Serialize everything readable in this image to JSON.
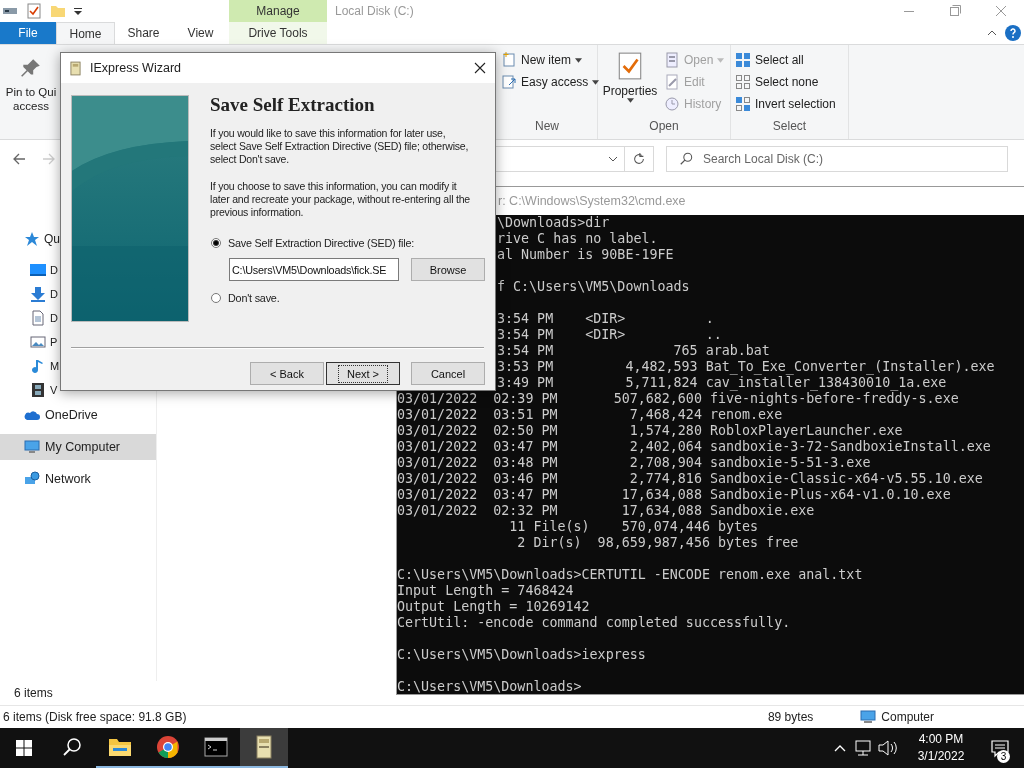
{
  "explorer": {
    "title": "Local Disk (C:)",
    "contextual_tab": "Manage",
    "tabs": [
      {
        "label": "File",
        "kind": "file",
        "selected": false
      },
      {
        "label": "Home",
        "kind": "normal",
        "selected": true
      },
      {
        "label": "Share",
        "kind": "normal",
        "selected": false
      },
      {
        "label": "View",
        "kind": "normal",
        "selected": false
      },
      {
        "label": "Drive Tools",
        "kind": "contextual",
        "selected": false
      }
    ],
    "ribbon": {
      "pin_lines": [
        "Pin to Qui",
        "access"
      ],
      "groups": [
        {
          "label": "New",
          "items": [
            {
              "label": "New item",
              "kind": "new-item",
              "dropdown": true,
              "disabled": false
            },
            {
              "label": "Easy access",
              "kind": "easy-access",
              "dropdown": true,
              "disabled": false
            }
          ]
        },
        {
          "label": "Open",
          "large": {
            "label": "Properties",
            "dropdown": true
          },
          "items": [
            {
              "label": "Open",
              "kind": "open",
              "dropdown": true,
              "disabled": true
            },
            {
              "label": "Edit",
              "kind": "edit",
              "dropdown": false,
              "disabled": true
            },
            {
              "label": "History",
              "kind": "history",
              "dropdown": false,
              "disabled": true
            }
          ]
        },
        {
          "label": "Select",
          "items": [
            {
              "label": "Select all",
              "kind": "select-all",
              "dropdown": false,
              "disabled": false
            },
            {
              "label": "Select none",
              "kind": "select-none",
              "dropdown": false,
              "disabled": false
            },
            {
              "label": "Invert selection",
              "kind": "invert",
              "dropdown": false,
              "disabled": false
            }
          ]
        }
      ]
    },
    "search": {
      "placeholder": "Search Local Disk (C:)"
    },
    "nav": [
      {
        "label": "Qu",
        "kind": "star",
        "selected": false,
        "children": [
          {
            "label": "D",
            "kind": "desktop",
            "selected": false
          },
          {
            "label": "D",
            "kind": "download",
            "selected": false
          },
          {
            "label": "D",
            "kind": "document",
            "selected": false
          },
          {
            "label": "P",
            "kind": "picture",
            "selected": false
          },
          {
            "label": "M",
            "kind": "music",
            "selected": false
          },
          {
            "label": "V",
            "kind": "video",
            "selected": false
          }
        ]
      },
      {
        "label": "OneDrive",
        "kind": "cloud",
        "selected": false
      },
      {
        "label": "My Computer",
        "kind": "computer",
        "selected": true
      },
      {
        "label": "Network",
        "kind": "network",
        "selected": false
      }
    ],
    "item_count": "6 items",
    "status_bar": {
      "summary": "6 items (Disk free space: 91.8 GB)",
      "size": "89 bytes",
      "zone": "Computer"
    }
  },
  "console": {
    "title": "r: C:\\Windows\\System32\\cmd.exe",
    "top_blocks": [
      [
        "\\Downloads>dir",
        "rive C has no label.",
        "al Number is 90BE-19FE"
      ],
      [
        "f C:\\Users\\VM5\\Downloads"
      ],
      [
        "3:54 PM    <DIR>          .",
        "3:54 PM    <DIR>          ..",
        "3:54 PM               765 arab.bat",
        "3:53 PM         4,482,593 Bat_To_Exe_Converter_(Installer).exe",
        "3:49 PM         5,711,824 cav_installer_138430010_1a.exe"
      ]
    ],
    "blocks": [
      [
        "03/01/2022  02:39 PM       507,682,600 five-nights-before-freddy-s.exe",
        "03/01/2022  03:51 PM         7,468,424 renom.exe",
        "03/01/2022  02:50 PM         1,574,280 RobloxPlayerLauncher.exe",
        "03/01/2022  03:47 PM         2,402,064 sandboxie-3-72-SandboxieInstall.exe",
        "03/01/2022  03:48 PM         2,708,904 sandboxie-5-51-3.exe",
        "03/01/2022  03:46 PM         2,774,816 Sandboxie-Classic-x64-v5.55.10.exe",
        "03/01/2022  03:47 PM        17,634,088 Sandboxie-Plus-x64-v1.0.10.exe",
        "03/01/2022  02:32 PM        17,634,088 Sandboxie.exe",
        "              11 File(s)    570,074,446 bytes",
        "               2 Dir(s)  98,659,987,456 bytes free"
      ],
      [
        "C:\\Users\\VM5\\Downloads>CERTUTIL -ENCODE renom.exe anal.txt",
        "Input Length = 7468424",
        "Output Length = 10269142",
        "CertUtil: -encode command completed successfully."
      ],
      [
        "C:\\Users\\VM5\\Downloads>iexpress"
      ],
      [
        "C:\\Users\\VM5\\Downloads>"
      ]
    ]
  },
  "wizard": {
    "title": "IExpress Wizard",
    "heading": "Save Self Extraction",
    "paragraphs": [
      "If you would like to save this information for later use, select Save Self Extraction Directive (SED) file; otherwise, select Don't save.",
      "If you choose to save this information, you can modify it later and recreate your package, without re-entering all the previous information."
    ],
    "options": [
      {
        "label": "Save Self Extraction Directive (SED) file:",
        "selected": true
      },
      {
        "label": "Don't save.",
        "selected": false
      }
    ],
    "path": "C:\\Users\\VM5\\Downloads\\fick.SE",
    "browse": "Browse",
    "buttons": [
      {
        "label": "< Back",
        "focused": false
      },
      {
        "label": "Next >",
        "focused": true
      },
      {
        "label": "Cancel",
        "focused": false
      }
    ]
  },
  "taskbar": {
    "apps": [
      {
        "kind": "explorer",
        "running": true,
        "active": false
      },
      {
        "kind": "browser",
        "running": true,
        "active": false
      },
      {
        "kind": "terminal",
        "running": true,
        "active": false
      },
      {
        "kind": "installer",
        "running": true,
        "active": true
      }
    ],
    "time": "4:00 PM",
    "date": "3/1/2022",
    "notifications": "3"
  }
}
